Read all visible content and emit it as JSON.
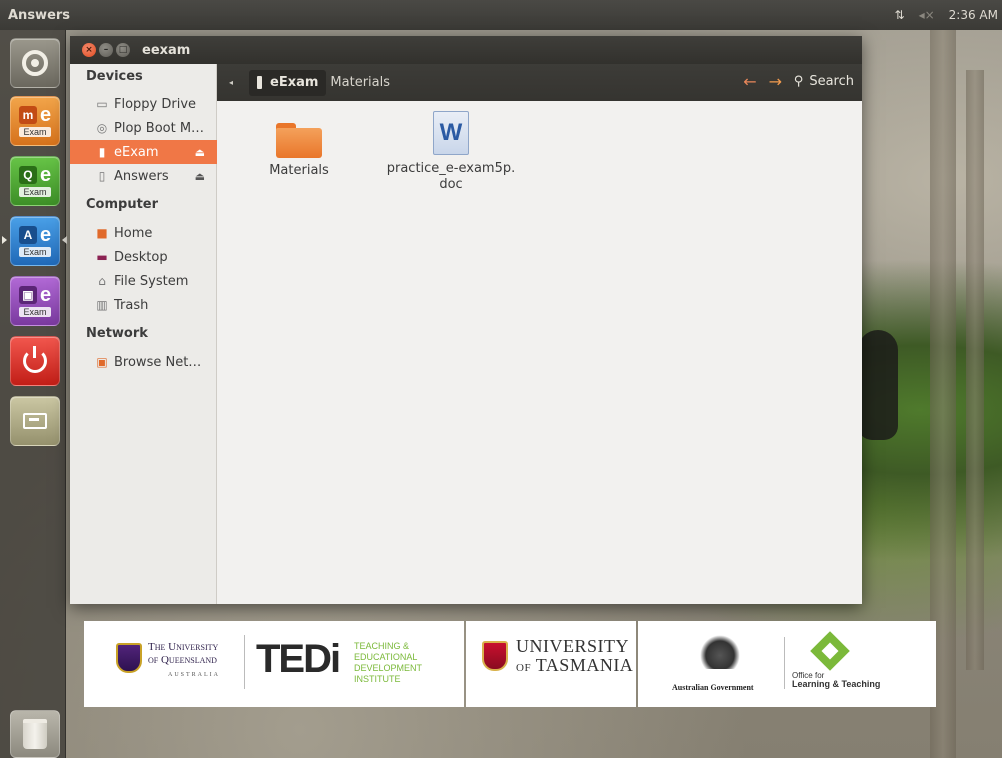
{
  "top_panel": {
    "title": "Answers",
    "time": "2:36 AM"
  },
  "launcher": {
    "items": [
      {
        "name": "dash",
        "label": ""
      },
      {
        "name": "m-exam",
        "badge": "m",
        "label": "Exam"
      },
      {
        "name": "q-exam",
        "badge": "Q",
        "label": "Exam"
      },
      {
        "name": "a-exam",
        "badge": "A",
        "label": "Exam"
      },
      {
        "name": "pres-exam",
        "badge": "▣",
        "label": "Exam"
      }
    ],
    "exam_letter": "e"
  },
  "window": {
    "title": "eexam",
    "sidebar": {
      "devices_header": "Devices",
      "devices": [
        {
          "label": "Floppy Drive",
          "icon": "floppy-icon"
        },
        {
          "label": "Plop Boot M…",
          "icon": "disc-icon"
        },
        {
          "label": "eExam",
          "icon": "usb-icon",
          "selected": true
        },
        {
          "label": "Answers",
          "icon": "usb-icon"
        }
      ],
      "computer_header": "Computer",
      "computer": [
        {
          "label": "Home",
          "icon": "home-folder-icon"
        },
        {
          "label": "Desktop",
          "icon": "desktop-icon"
        },
        {
          "label": "File System",
          "icon": "drive-icon"
        },
        {
          "label": "Trash",
          "icon": "trash-icon"
        }
      ],
      "network_header": "Network",
      "network": [
        {
          "label": "Browse Net…",
          "icon": "network-icon"
        }
      ]
    },
    "toolbar": {
      "crumb_active": "eExam",
      "crumb_next": "Materials",
      "search_label": "Search"
    },
    "files": [
      {
        "name": "Materials",
        "type": "folder"
      },
      {
        "name_line1": "practice_e-exam5p.",
        "name_line2": "doc",
        "type": "word-doc",
        "glyph": "W"
      }
    ]
  },
  "banner": {
    "uq_line1": "The University",
    "uq_line2": "of Queensland",
    "uq_line3": "AUSTRALIA",
    "tedi": "TEDi",
    "tedi_line1": "TEACHING & EDUCATIONAL",
    "tedi_line2": "DEVELOPMENT INSTITUTE",
    "utas_line1": "UNIVERSITY",
    "utas_of": "OF",
    "utas_line2": "TASMANIA",
    "gov": "Australian Government",
    "olt_line1": "Office for",
    "olt_line2": "Learning & Teaching"
  }
}
